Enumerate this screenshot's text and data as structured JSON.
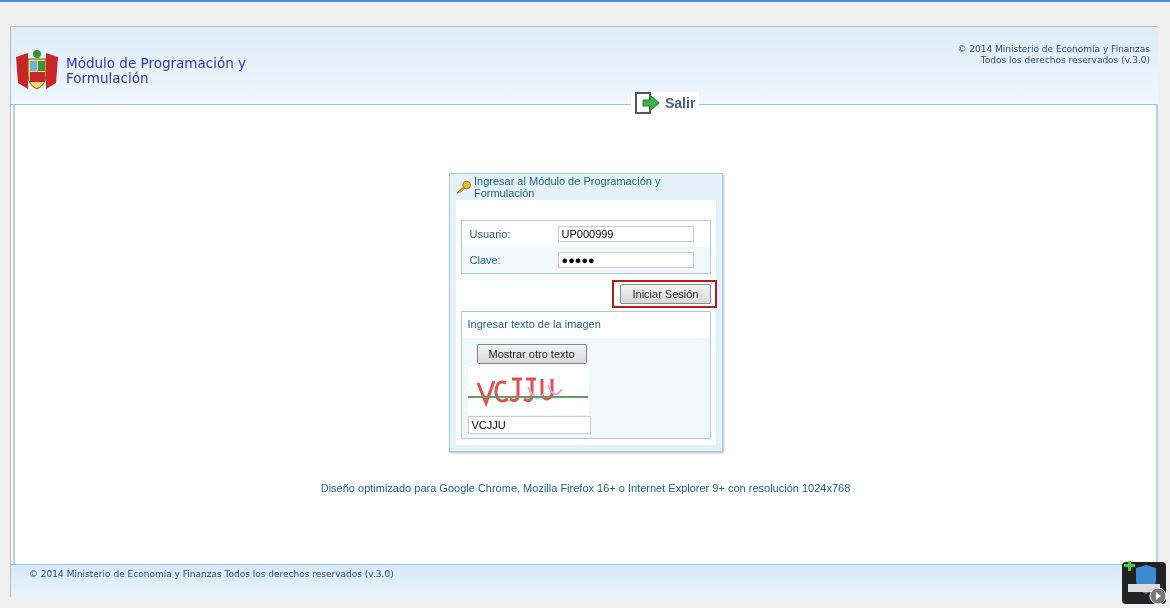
{
  "header": {
    "title_line1": "Módulo de Programación y",
    "title_line2": "Formulación",
    "copyright_line1": "© 2014 Ministerio de Economía y Finanzas",
    "copyright_line2": "Todos los derechos reservados (v.3.0)",
    "logout": "Salir"
  },
  "login": {
    "title": "Ingresar al Módulo de Programación y Formulación",
    "fields": [
      {
        "label": "Usuario:",
        "value": "UP000999"
      },
      {
        "label": "Clave:",
        "value": "●●●●●"
      }
    ],
    "submit": {
      "label": "Iniciar Sesión",
      "highlighted": true
    },
    "captcha": {
      "title": "Ingresar texto de la imagen",
      "refresh": "Mostrar otro texto",
      "value": "VCJJU"
    }
  },
  "note": "Diseño optimizado para Google Chrome, Mozilla Firefox 16+ o Internet Explorer 9+ con resolución 1024x768",
  "footer": "© 2014 Ministerio de Economía y Finanzas Todos los derechos reservados (v.3.0)"
}
